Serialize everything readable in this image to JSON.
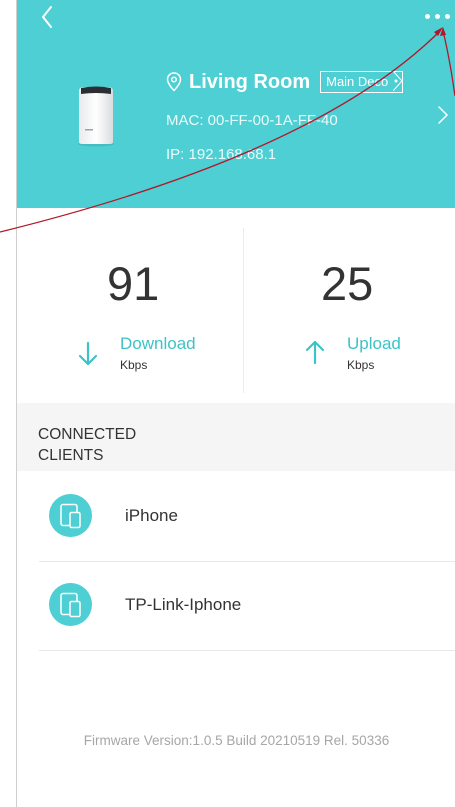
{
  "header": {
    "location_name": "Living Room",
    "badge_label": "Main Deco",
    "mac_text": "MAC: 00-FF-00-1A-FF-40",
    "ip_text": "IP: 192.168.68.1"
  },
  "stats": {
    "download": {
      "value": "91",
      "label": "Download",
      "unit": "Kbps"
    },
    "upload": {
      "value": "25",
      "label": "Upload",
      "unit": "Kbps"
    }
  },
  "clients_section": {
    "title": "CONNECTED CLIENTS",
    "items": [
      {
        "name": "iPhone",
        "icon": "device-icon"
      },
      {
        "name": "TP-Link-Iphone",
        "icon": "device-icon"
      }
    ]
  },
  "footer": {
    "firmware": "Firmware Version:1.0.5 Build 20210519 Rel. 50336"
  },
  "colors": {
    "header_bg": "#4ecfd3",
    "accent": "#3cc3c8",
    "annotation": "#b0182a"
  },
  "icons": [
    "back-icon",
    "more-icon",
    "location-pin-icon",
    "chevron-right-icon",
    "download-arrow-icon",
    "upload-arrow-icon",
    "device-icon"
  ]
}
